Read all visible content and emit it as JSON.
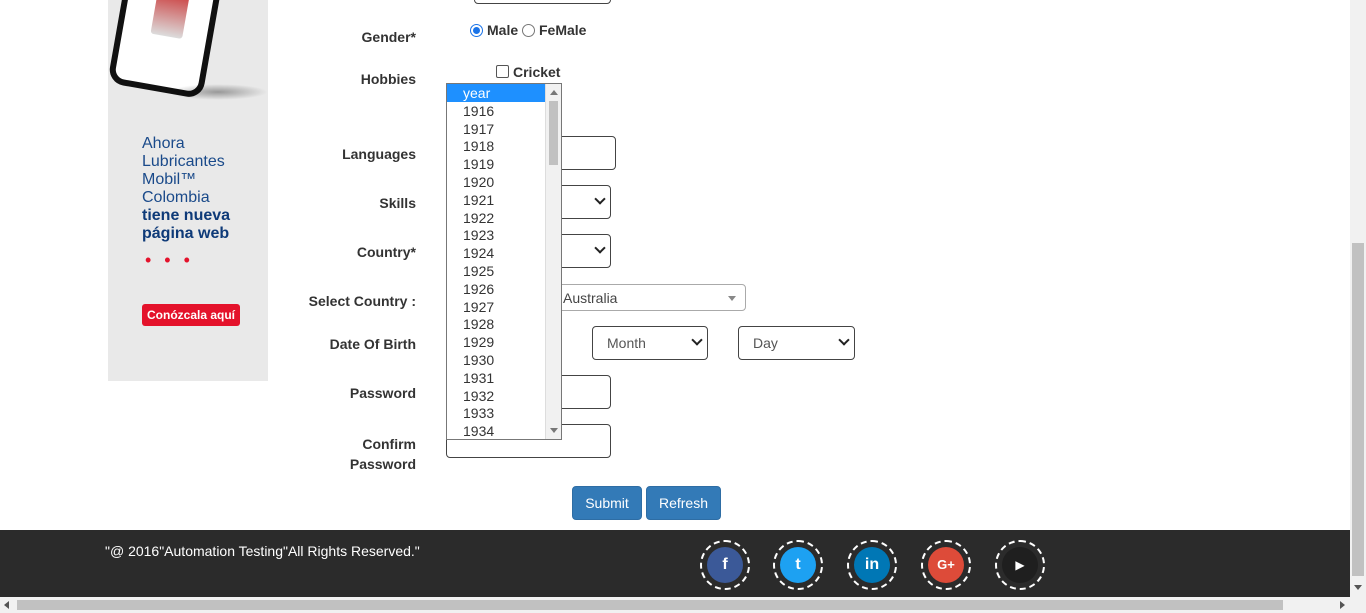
{
  "ad": {
    "text_lines": [
      "Ahora",
      "Lubricantes",
      "Mobil™",
      "Colombia"
    ],
    "text_bold_lines": [
      "tiene nueva",
      "página web"
    ],
    "dots": "• • •",
    "cta": "Conózcala aquí"
  },
  "form": {
    "gender": {
      "label": "Gender*",
      "options": [
        {
          "label": "Male",
          "selected": true
        },
        {
          "label": "FeMale",
          "selected": false
        }
      ]
    },
    "hobbies": {
      "label": "Hobbies",
      "first_option": "Cricket"
    },
    "languages": {
      "label": "Languages"
    },
    "skills": {
      "label": "Skills"
    },
    "country": {
      "label": "Country*"
    },
    "select_country": {
      "label": "Select Country :",
      "value": "Australia"
    },
    "dob": {
      "label": "Date Of Birth",
      "month": "Month",
      "day": "Day",
      "year_list": [
        "year",
        "1916",
        "1917",
        "1918",
        "1919",
        "1920",
        "1921",
        "1922",
        "1923",
        "1924",
        "1925",
        "1926",
        "1927",
        "1928",
        "1929",
        "1930",
        "1931",
        "1932",
        "1933",
        "1934"
      ]
    },
    "password": {
      "label": "Password"
    },
    "confirm_password": {
      "label_line1": "Confirm",
      "label_line2": "Password"
    },
    "submit": "Submit",
    "refresh": "Refresh"
  },
  "footer": {
    "copyright": "\"@ 2016\"Automation Testing\"All Rights Reserved.\"",
    "social": [
      {
        "name": "facebook",
        "glyph": "f",
        "color": "#3b5998"
      },
      {
        "name": "twitter",
        "glyph": "t",
        "color": "#1da1f2"
      },
      {
        "name": "linkedin",
        "glyph": "in",
        "color": "#0077b5"
      },
      {
        "name": "google-plus",
        "glyph": "G+",
        "color": "#dd4b39"
      },
      {
        "name": "youtube",
        "glyph": "▶",
        "color": "#1f1f1f"
      }
    ]
  },
  "colors": {
    "primary_button": "#337ab7",
    "footer_bg": "#2b2b2b",
    "selected_option": "#1e90ff",
    "ad_accent": "#e4122b"
  }
}
